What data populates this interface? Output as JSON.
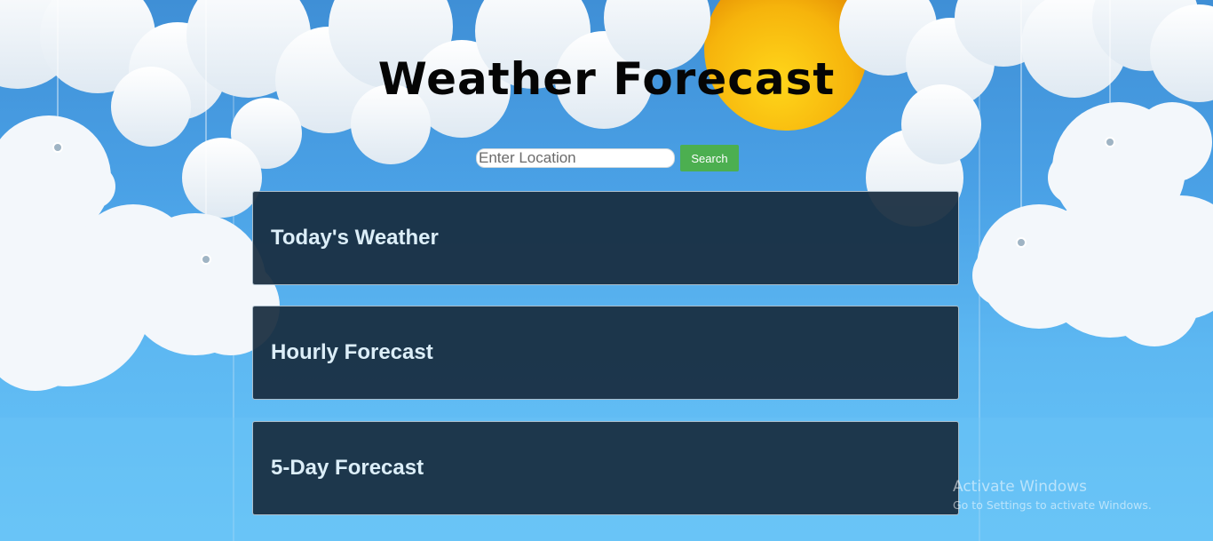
{
  "header": {
    "title": "Weather Forecast"
  },
  "search": {
    "placeholder": "Enter Location",
    "value": "",
    "button_label": "Search"
  },
  "sections": [
    {
      "title": "Today's Weather"
    },
    {
      "title": "Hourly Forecast"
    },
    {
      "title": "5-Day Forecast"
    }
  ],
  "colors": {
    "search_button": "#4caf50",
    "panel_background": "#182c3e",
    "panel_text": "#dceef8",
    "sky": "#4aa1e6",
    "sun": "#f5b20e"
  },
  "watermark": {
    "title": "Activate Windows",
    "subtitle": "Go to Settings to activate Windows."
  }
}
